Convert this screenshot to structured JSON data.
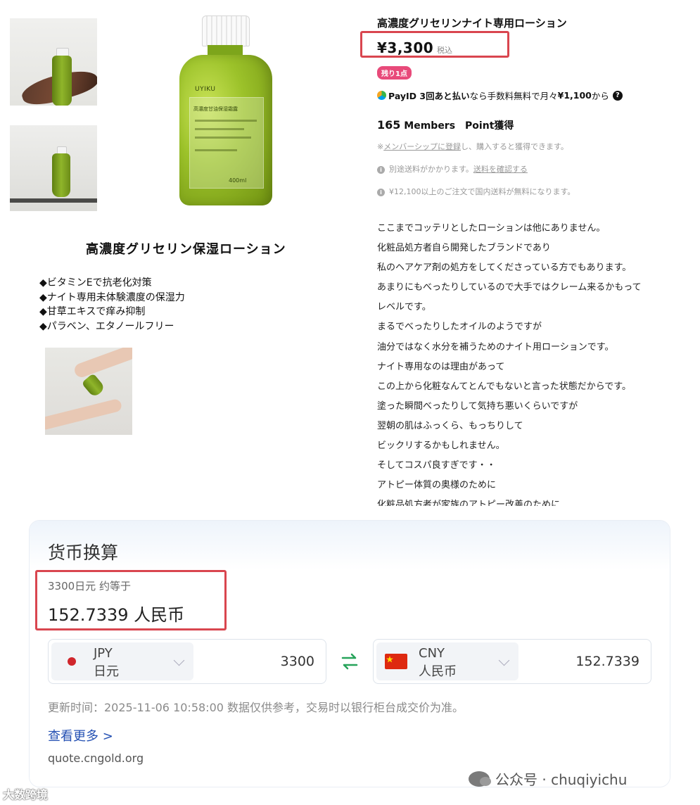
{
  "product": {
    "title": "高濃度グリセリンナイト専用ローション",
    "price": "¥3,300",
    "tax_label": "税込",
    "stock_badge": "残り1点",
    "payid_bold": "PayID 3回あと払い",
    "payid_rest": "なら手数料無料で月々",
    "payid_amount": "¥1,100",
    "payid_suffix": "から",
    "help_icon": "?",
    "points_number": "165",
    "points_label": " Members　Point獲得",
    "membership_prefix": "※",
    "membership_link": "メンバーシップに登録",
    "membership_rest": "し、購入すると獲得できます。",
    "shipping_note": "別途送料がかかります。",
    "shipping_link": "送料を確認する",
    "free_shipping_note": "¥12,100以上のご注文で国内送料が無料になります。",
    "info_icon": "i",
    "colors": {
      "price_box": "#d9464f",
      "badge": "#e84a7a"
    }
  },
  "banner": {
    "title": "高濃度グリセリン保湿ローション",
    "bullets": [
      "◆ビタミンEで抗老化対策",
      "◆ナイト専用未体験濃度の保湿力",
      "◆甘草エキスで痒み抑制",
      "◆パラベン、エタノールフリー"
    ],
    "bottle_brand": "UYIKU",
    "bottle_label": "高濃度甘油保湿霜露",
    "bottle_volume": "400ml"
  },
  "description": [
    "ここまでコッテリとしたローションは他にありません。",
    "化粧品処方者自ら開発したブランドであり",
    "私のヘアケア剤の処方をしてくださっている方でもあります。",
    "あまりにもべったりしているので大手ではクレーム来るかもって",
    "レベルです。",
    "まるでべったりしたオイルのようですが",
    "油分ではなく水分を補うためのナイト用ローションです。",
    "ナイト専用なのは理由があって",
    "この上から化粧なんてとんでもないと言った状態だからです。",
    "塗った瞬間べったりして気持ち悪いくらいですが",
    "翌朝の肌はふっくら、もっちりして",
    "ビックリするかもしれません。",
    "そしてコスパ良すぎです・・",
    "アトピー体質の奥様のために",
    "化粧品処方者が家族のアトピー改善のために"
  ],
  "converter": {
    "title": "货币换算",
    "from_line": "3300日元 约等于",
    "result": "152.7339 人民币",
    "from": {
      "code": "JPY",
      "name": "日元",
      "value": "3300",
      "flag_color": "#d0262c"
    },
    "to": {
      "code": "CNY",
      "name": "人民币",
      "value": "152.7339",
      "flag_color": "#de2910"
    },
    "update_text": "更新时间：2025-11-06 10:58:00 数据仅供参考，交易时以银行柜台成交价为准。",
    "more_link": "查看更多 >",
    "source": "quote.cngold.org",
    "colors": {
      "swap_icon": "#27a35a",
      "link": "#2450b3"
    }
  },
  "watermarks": {
    "right": "公众号 · chuqiyichu",
    "left": "大数跨境"
  }
}
